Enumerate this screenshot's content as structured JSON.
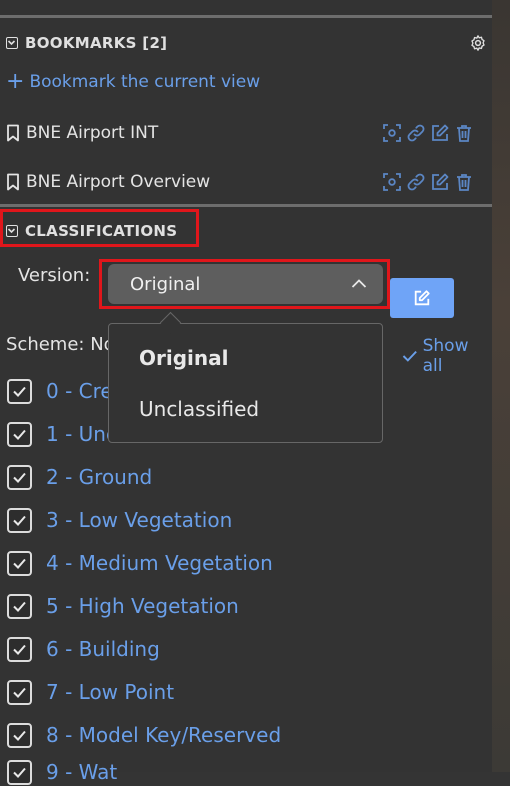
{
  "bookmarks": {
    "header": "BOOKMARKS [2]",
    "add_label": "Bookmark the current view",
    "items": [
      {
        "title": "BNE Airport INT"
      },
      {
        "title": "BNE Airport Overview"
      }
    ],
    "icons": [
      "bookmark-icon",
      "zoom-to-icon",
      "link-icon",
      "edit-icon",
      "trash-icon",
      "gear-icon",
      "plus-icon",
      "collapse-chevron-icon"
    ]
  },
  "classifications": {
    "header": "CLASSIFICATIONS",
    "version_label": "Version:",
    "version_value": "Original",
    "version_options": [
      "Original",
      "Unclassified"
    ],
    "scheme_label": "Scheme: No",
    "show_all_label": "Show all",
    "items": [
      {
        "label": "0 - Cre",
        "checked": true
      },
      {
        "label": "1 - Unc",
        "checked": true
      },
      {
        "label": "2 - Ground",
        "checked": true
      },
      {
        "label": "3 - Low Vegetation",
        "checked": true
      },
      {
        "label": "4 - Medium Vegetation",
        "checked": true
      },
      {
        "label": "5 - High Vegetation",
        "checked": true
      },
      {
        "label": "6 - Building",
        "checked": true
      },
      {
        "label": "7 - Low Point",
        "checked": true
      },
      {
        "label": "8 - Model Key/Reserved",
        "checked": true
      },
      {
        "label": "9 - Wat",
        "checked": true
      }
    ]
  },
  "colors": {
    "panel_bg": "#333333",
    "accent_blue": "#6a9fe9",
    "button_blue": "#6fa4f7",
    "highlight_red": "#e0161b",
    "select_bg": "#5e5e5e"
  }
}
